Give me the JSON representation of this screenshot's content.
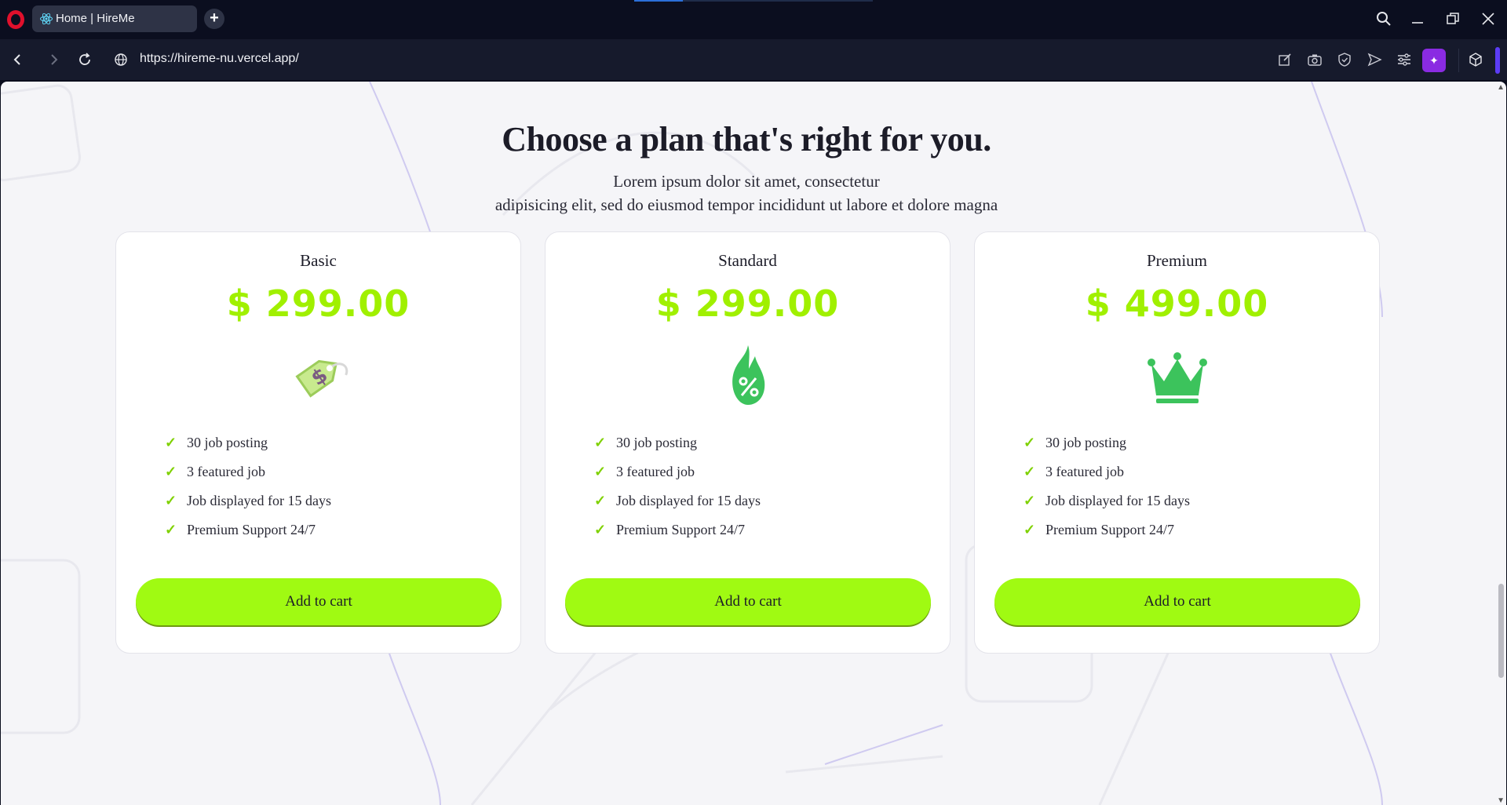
{
  "browser": {
    "tab_title": "Home | HireMe",
    "url": "https://hireme-nu.vercel.app/"
  },
  "page": {
    "heading": "Choose a plan that's right for you.",
    "subtitle_line1": "Lorem ipsum dolor sit amet, consectetur",
    "subtitle_line2": "adipisicing elit, sed do eiusmod tempor incididunt ut labore et dolore magna",
    "plans": [
      {
        "name": "Basic",
        "price": "$ 299.00",
        "icon": "price-tag-icon",
        "features": [
          "30 job posting",
          "3 featured job",
          "Job displayed for 15 days",
          "Premium Support 24/7"
        ],
        "button": "Add to cart"
      },
      {
        "name": "Standard",
        "price": "$ 299.00",
        "icon": "discount-flame-icon",
        "features": [
          "30 job posting",
          "3 featured job",
          "Job displayed for 15 days",
          "Premium Support 24/7"
        ],
        "button": "Add to cart"
      },
      {
        "name": "Premium",
        "price": "$ 499.00",
        "icon": "crown-icon",
        "features": [
          "30 job posting",
          "3 featured job",
          "Job displayed for 15 days",
          "Premium Support 24/7"
        ],
        "button": "Add to cart"
      }
    ]
  },
  "colors": {
    "accent": "#a0fa12",
    "price": "#a0f000",
    "check": "#7fd100",
    "icon_green": "#3cc35c"
  }
}
